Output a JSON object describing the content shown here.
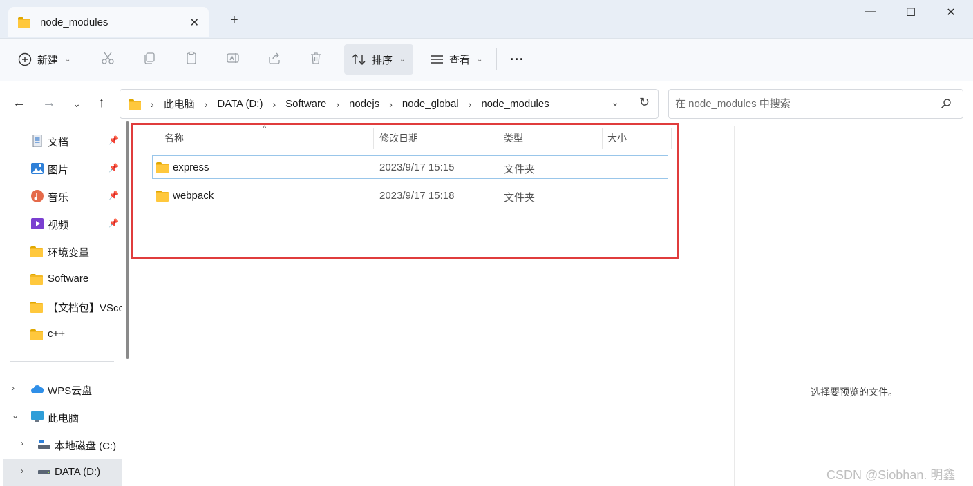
{
  "window": {
    "tab_title": "node_modules",
    "tab_close": "✕",
    "new_tab": "+",
    "minimize": "—",
    "maximize": "☐",
    "close": "✕"
  },
  "toolbar": {
    "new_label": "新建",
    "sort_label": "排序",
    "view_label": "查看",
    "more_label": "···"
  },
  "address": {
    "breadcrumbs": [
      "此电脑",
      "DATA (D:)",
      "Software",
      "nodejs",
      "node_global",
      "node_modules"
    ],
    "search_placeholder": "在 node_modules 中搜索"
  },
  "sidebar": {
    "items": [
      {
        "label": "文档"
      },
      {
        "label": "图片"
      },
      {
        "label": "音乐"
      },
      {
        "label": "视频"
      },
      {
        "label": "环境变量"
      },
      {
        "label": "Software"
      },
      {
        "label": "【文档包】VScode"
      },
      {
        "label": "c++"
      },
      {
        "label": "WPS云盘"
      },
      {
        "label": "此电脑"
      },
      {
        "label": "本地磁盘 (C:)"
      },
      {
        "label": "DATA (D:)"
      }
    ]
  },
  "columns": {
    "name": "名称",
    "date": "修改日期",
    "type": "类型",
    "size": "大小"
  },
  "files": [
    {
      "name": "express",
      "date": "2023/9/17 15:15",
      "type": "文件夹",
      "size": ""
    },
    {
      "name": "webpack",
      "date": "2023/9/17 15:18",
      "type": "文件夹",
      "size": ""
    }
  ],
  "preview": {
    "empty_text": "选择要预览的文件。"
  },
  "watermark": "CSDN @Siobhan. 明鑫",
  "colors": {
    "highlight_border": "#e03c3c",
    "folder": "#ffc83d",
    "selection_border": "#99c6ea"
  }
}
